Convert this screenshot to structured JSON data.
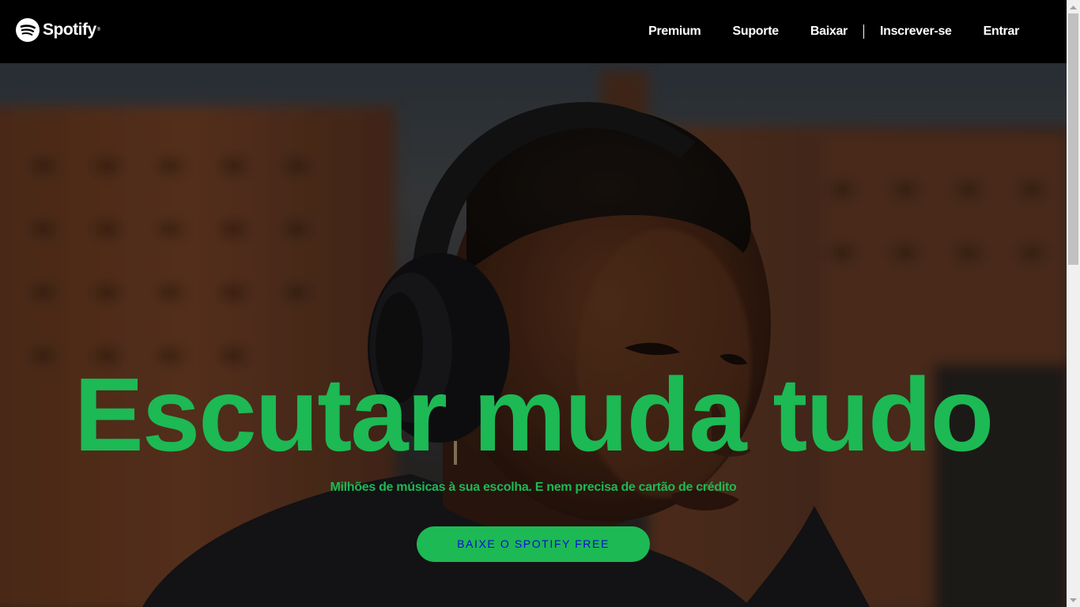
{
  "header": {
    "brand": "Spotify",
    "brand_mark": "®",
    "nav": [
      {
        "label": "Premium"
      },
      {
        "label": "Suporte"
      },
      {
        "label": "Baixar"
      },
      {
        "label": "Inscrever-se"
      },
      {
        "label": "Entrar"
      }
    ]
  },
  "hero": {
    "title": "Escutar muda tudo",
    "subtitle": "Milhões de músicas à sua escolha. E nem precisa de cartão de crédito",
    "cta_label": "BAIXE O SPOTIFY FREE"
  },
  "colors": {
    "brand_green": "#1db954",
    "header_bg": "#000000",
    "cta_text": "#0a0ad9"
  },
  "icons": {
    "logo": "spotify-logo-icon",
    "scroll_up": "chevron-up-icon",
    "scroll_down": "chevron-down-icon"
  }
}
